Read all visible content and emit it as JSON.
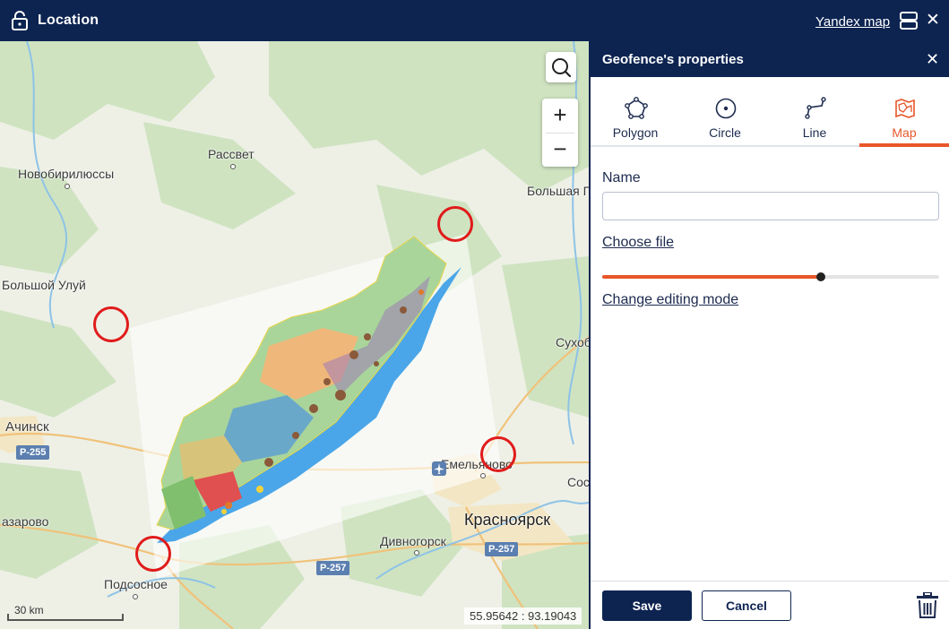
{
  "header": {
    "title": "Location",
    "map_provider_link": "Yandex map",
    "close_symbol": "✕"
  },
  "map": {
    "labels": {
      "rassvet": "Рассвет",
      "novobirilyussy": "Новобирилюссы",
      "bolshaya": "Большая Г",
      "bolshoy_uluy": "Большой Улуй",
      "sukhob": "Сухоб",
      "achinsk": "Ачинск",
      "emelyanovo": "Емельяново",
      "sos": "Сос",
      "nazarovo": "азарово",
      "krasnoyarsk": "Красноярск",
      "divnogorsk": "Дивногорск",
      "podsosnoe": "Подсосное"
    },
    "roads": {
      "r255": "Р-255",
      "r257a": "Р-257",
      "r257b": "Р-257"
    },
    "zoom_in": "+",
    "zoom_out": "−",
    "scale_label": "30 km",
    "coordinates": "55.95642 : 93.19043",
    "icons": [
      "search-icon",
      "lock-icon",
      "layout-icon",
      "close-icon",
      "airport-icon"
    ],
    "colors": {
      "marker": "#e01b1b",
      "river": "#4aa6e8",
      "forest": "#cfe3c1"
    }
  },
  "panel": {
    "title": "Geofence's properties",
    "close_symbol": "✕",
    "tabs": [
      {
        "label": "Polygon",
        "icon": "polygon-icon",
        "active": false
      },
      {
        "label": "Circle",
        "icon": "circle-icon",
        "active": false
      },
      {
        "label": "Line",
        "icon": "line-icon",
        "active": false
      },
      {
        "label": "Map",
        "icon": "map-icon",
        "active": true
      }
    ],
    "name_label": "Name",
    "name_value": "",
    "choose_file": "Choose file",
    "opacity_fraction": 0.65,
    "change_mode": "Change editing mode",
    "save": "Save",
    "cancel": "Cancel",
    "colors": {
      "primary": "#0d2451",
      "accent": "#e8562a"
    }
  }
}
